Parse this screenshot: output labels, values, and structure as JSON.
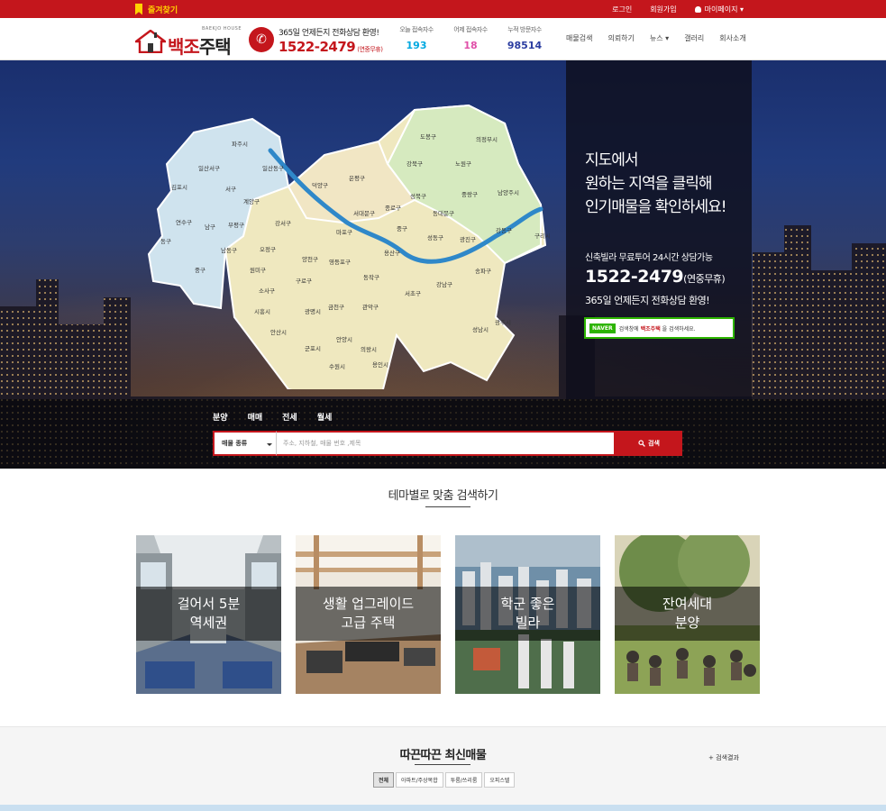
{
  "topbar": {
    "bookmark_label": "즐겨찾기",
    "links": [
      "로그인",
      "회원가입",
      "마이페이지 ▾"
    ]
  },
  "header": {
    "logo_main_red": "백조",
    "logo_main_dark": "주택",
    "logo_sub": "BAEKJO HOUSE",
    "phone_tagline": "365일 언제든지 전화상담 환영!",
    "phone_number": "1522-2479",
    "phone_note": "(연중무휴)",
    "stats": [
      {
        "label": "오늘 접속자수",
        "value": "193",
        "color": "#00a8e0"
      },
      {
        "label": "어제 접속자수",
        "value": "18",
        "color": "#e04fa8"
      },
      {
        "label": "누적 방문자수",
        "value": "98514",
        "color": "#2b3da0"
      }
    ],
    "nav": [
      "매물검색",
      "의뢰하기",
      "뉴스 ▾",
      "갤러리",
      "회사소개"
    ]
  },
  "map": {
    "regions": [
      {
        "name": "파주시"
      },
      {
        "name": "일산서구"
      },
      {
        "name": "일산동구"
      },
      {
        "name": "김포시"
      },
      {
        "name": "서구"
      },
      {
        "name": "계양구"
      },
      {
        "name": "연수구"
      },
      {
        "name": "남구"
      },
      {
        "name": "부평구"
      },
      {
        "name": "동구"
      },
      {
        "name": "남동구"
      },
      {
        "name": "중구"
      },
      {
        "name": "강서구"
      },
      {
        "name": "오정구"
      },
      {
        "name": "원미구"
      },
      {
        "name": "소사구"
      },
      {
        "name": "시흥시"
      },
      {
        "name": "안산시"
      },
      {
        "name": "덕양구"
      },
      {
        "name": "은평구"
      },
      {
        "name": "서대문구"
      },
      {
        "name": "마포구"
      },
      {
        "name": "양천구"
      },
      {
        "name": "영등포구"
      },
      {
        "name": "구로구"
      },
      {
        "name": "광명시"
      },
      {
        "name": "금천구"
      },
      {
        "name": "동작구"
      },
      {
        "name": "관악구"
      },
      {
        "name": "안양시"
      },
      {
        "name": "군포시"
      },
      {
        "name": "의왕시"
      },
      {
        "name": "수원시"
      },
      {
        "name": "용인시"
      },
      {
        "name": "도봉구"
      },
      {
        "name": "강북구"
      },
      {
        "name": "노원구"
      },
      {
        "name": "성북구"
      },
      {
        "name": "종로구"
      },
      {
        "name": "중구"
      },
      {
        "name": "용산구"
      },
      {
        "name": "동대문구"
      },
      {
        "name": "중랑구"
      },
      {
        "name": "성동구"
      },
      {
        "name": "광진구"
      },
      {
        "name": "강남구"
      },
      {
        "name": "서초구"
      },
      {
        "name": "송파구"
      },
      {
        "name": "강동구"
      },
      {
        "name": "성남시"
      },
      {
        "name": "의정부시"
      },
      {
        "name": "남양주시"
      },
      {
        "name": "구리시"
      },
      {
        "name": "광주시"
      }
    ]
  },
  "hero": {
    "title": "지도에서\n원하는 지역을 클릭해\n인기매물을 확인하세요!",
    "line1": "신축빌라 무료투어 24시간 상담가능",
    "phone": "1522-2479",
    "phone_note": "(연중무휴)",
    "line3": "365일 언제든지 전화상담 환영!",
    "naver_logo": "NAVER",
    "naver_pre": "검색창에",
    "naver_brand": "백조주택",
    "naver_post": "을 검색하세요."
  },
  "search": {
    "tabs": [
      "분양",
      "매매",
      "전세",
      "월세"
    ],
    "select_value": "매물 종류",
    "placeholder": "주소, 지하철, 매물 번호 ,제목",
    "button": "검색"
  },
  "theme": {
    "title": "테마별로 맞춤 검색하기",
    "cards": [
      {
        "label": "걸어서 5분\n역세권"
      },
      {
        "label": "생활 업그레이드\n고급 주택"
      },
      {
        "label": "학군 좋은\n빌라"
      },
      {
        "label": "잔여세대\n분양"
      }
    ]
  },
  "latest": {
    "title": "따끈따끈 최신매물",
    "more": "+ 검색결과",
    "tabs": [
      "전체",
      "아파트/주상복합",
      "투룸/쓰리룸",
      "오피스텔"
    ]
  }
}
